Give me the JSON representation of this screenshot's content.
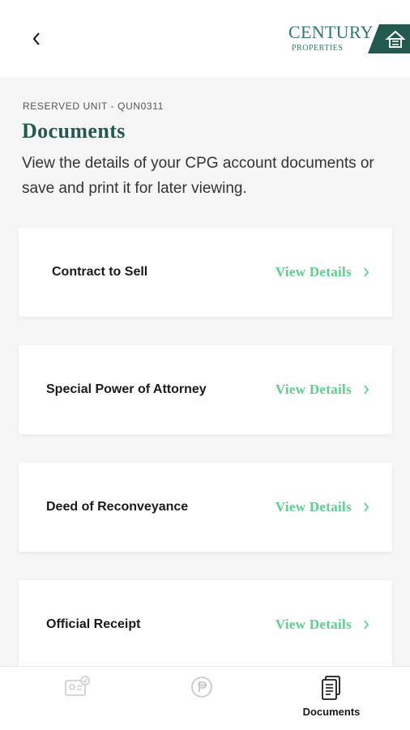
{
  "header": {
    "back_icon": "chevron-left-icon",
    "logo": {
      "word": "CENTURY",
      "sub": "PROPERTIES"
    }
  },
  "page": {
    "eyebrow": "RESERVED UNIT - QUN0311",
    "title": "Documents",
    "description": "View the details of your CPG account documents or save and print it for later viewing."
  },
  "documents": [
    {
      "title": "Contract to Sell",
      "action": "View Details"
    },
    {
      "title": "Special Power of Attorney",
      "action": "View Details"
    },
    {
      "title": "Deed of Reconveyance",
      "action": "View Details"
    },
    {
      "title": "Official Receipt",
      "action": "View Details"
    }
  ],
  "bottom_nav": [
    {
      "icon": "id-card-check-icon",
      "label": "",
      "active": false
    },
    {
      "icon": "peso-coin-icon",
      "label": "",
      "active": false
    },
    {
      "icon": "document-stack-icon",
      "label": "Documents",
      "active": true
    }
  ],
  "colors": {
    "brand_green": "#2f7c66",
    "title_green": "#23594f",
    "link_green": "#5bd08c",
    "background": "#f6f6f6"
  }
}
